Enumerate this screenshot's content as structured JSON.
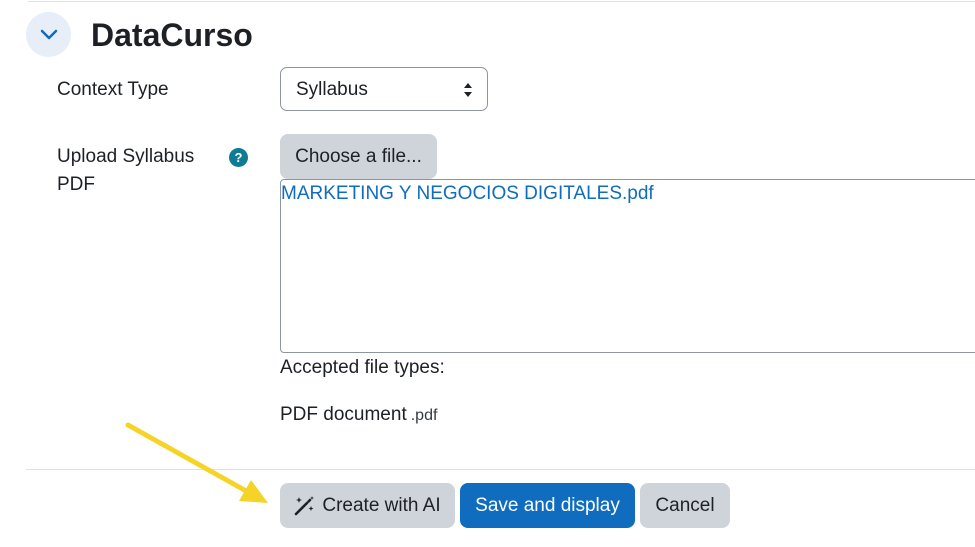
{
  "section": {
    "title": "DataCurso",
    "collapse_icon": "chevron-down-icon"
  },
  "context_type": {
    "label": "Context Type",
    "selected": "Syllabus"
  },
  "upload": {
    "label": "Upload Syllabus PDF",
    "help_icon": "?",
    "choose_button": "Choose a file...",
    "file_name": "MARKETING Y NEGOCIOS DIGITALES.pdf",
    "accepted_label": "Accepted file types:",
    "file_type_name": "PDF document",
    "file_type_ext": ".pdf"
  },
  "actions": {
    "create_ai": "Create with AI",
    "save_display": "Save and display",
    "cancel": "Cancel"
  },
  "colors": {
    "primary": "#0f6cbf",
    "secondary": "#ced4da",
    "help": "#0f7b94",
    "annotation_arrow": "#f5d327"
  }
}
